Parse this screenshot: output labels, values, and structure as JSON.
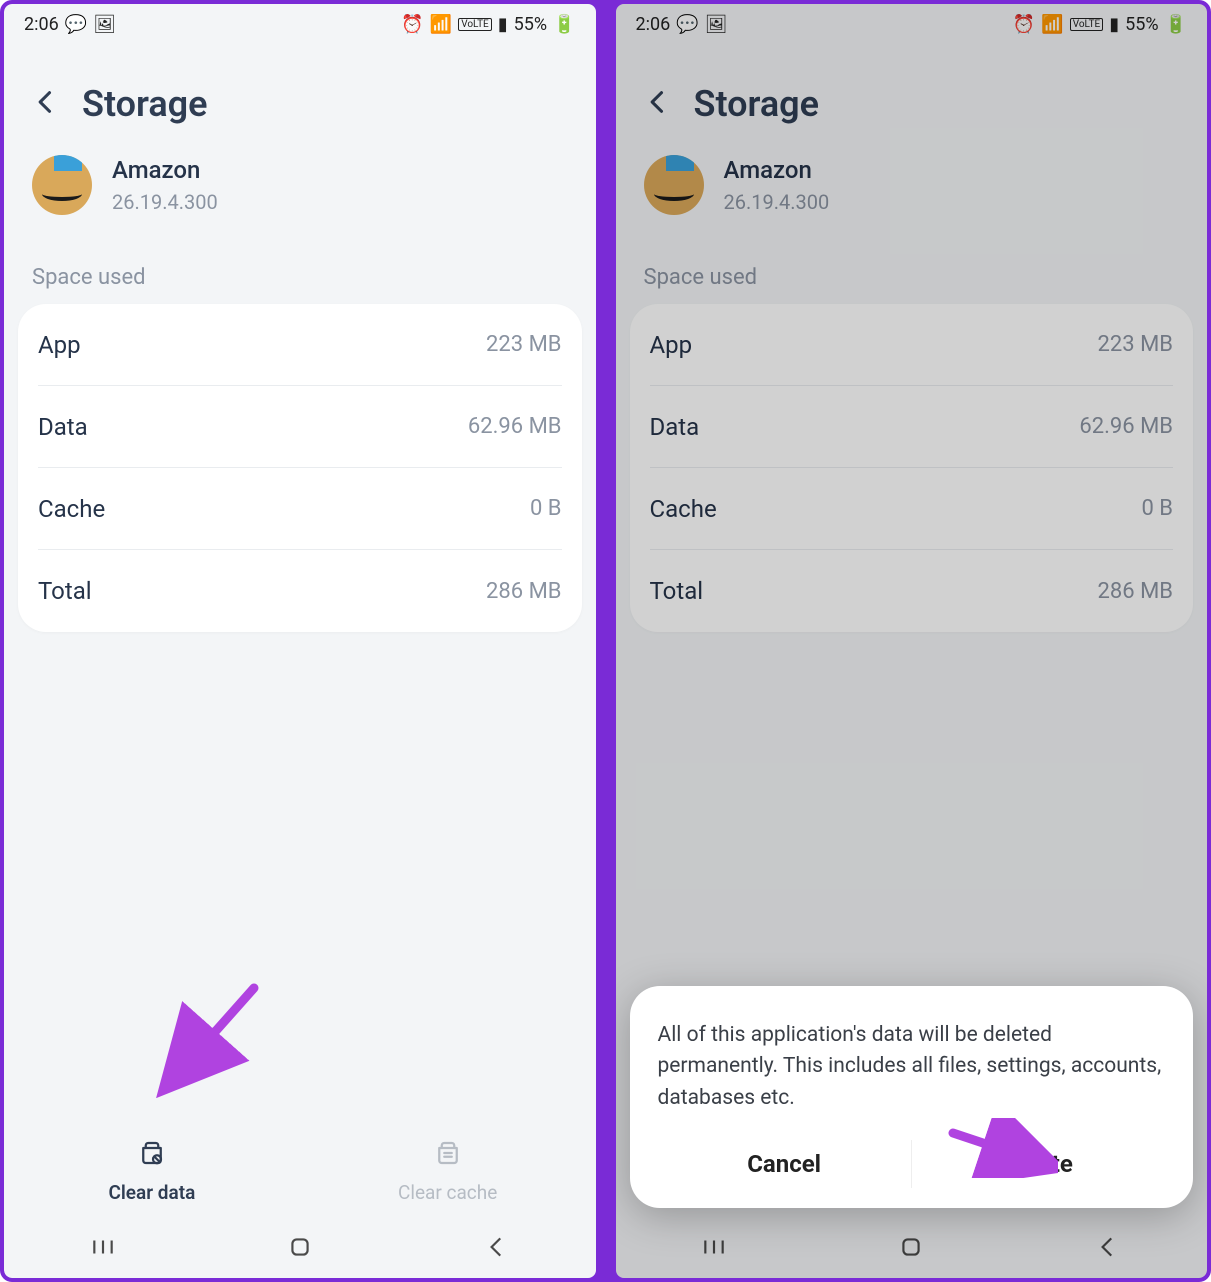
{
  "status": {
    "time": "2:06",
    "battery": "55%"
  },
  "header": {
    "title": "Storage"
  },
  "app": {
    "name": "Amazon",
    "version": "26.19.4.300"
  },
  "section_label": "Space used",
  "rows": [
    {
      "label": "App",
      "value": "223 MB"
    },
    {
      "label": "Data",
      "value": "62.96 MB"
    },
    {
      "label": "Cache",
      "value": "0 B"
    },
    {
      "label": "Total",
      "value": "286 MB"
    }
  ],
  "actions": {
    "clear_data": "Clear data",
    "clear_cache": "Clear cache"
  },
  "dialog": {
    "message": "All of this application's data will be deleted permanently. This includes all files, settings, accounts, databases etc.",
    "cancel": "Cancel",
    "delete": "Delete"
  }
}
